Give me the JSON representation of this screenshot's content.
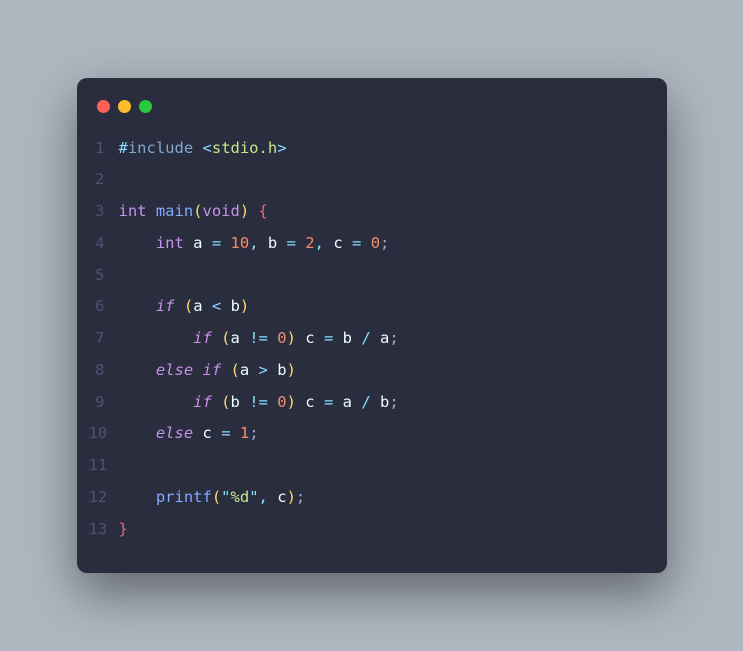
{
  "window": {
    "traffic_lights": {
      "red": "#ff5f56",
      "yellow": "#ffbd2e",
      "green": "#27c93f"
    }
  },
  "code": {
    "language": "c",
    "lines": [
      {
        "num": "1",
        "tokens": [
          [
            "mtk-dir",
            "#"
          ],
          [
            "mtk-include",
            "include"
          ],
          [
            "plain",
            " "
          ],
          [
            "mtk-dir",
            "<"
          ],
          [
            "mtk-str",
            "stdio.h"
          ],
          [
            "mtk-dir",
            ">"
          ]
        ]
      },
      {
        "num": "2",
        "tokens": []
      },
      {
        "num": "3",
        "tokens": [
          [
            "mtk-type",
            "int"
          ],
          [
            "plain",
            " "
          ],
          [
            "mtk-fn",
            "main"
          ],
          [
            "mtk-paren",
            "("
          ],
          [
            "mtk-type",
            "void"
          ],
          [
            "mtk-paren",
            ")"
          ],
          [
            "plain",
            " "
          ],
          [
            "mtk-brace",
            "{"
          ]
        ]
      },
      {
        "num": "4",
        "tokens": [
          [
            "plain",
            "    "
          ],
          [
            "mtk-type",
            "int"
          ],
          [
            "plain",
            " "
          ],
          [
            "mtk-var",
            "a"
          ],
          [
            "plain",
            " "
          ],
          [
            "mtk-op",
            "="
          ],
          [
            "plain",
            " "
          ],
          [
            "mtk-num",
            "10"
          ],
          [
            "mtk-punc",
            ","
          ],
          [
            "plain",
            " "
          ],
          [
            "mtk-var",
            "b"
          ],
          [
            "plain",
            " "
          ],
          [
            "mtk-op",
            "="
          ],
          [
            "plain",
            " "
          ],
          [
            "mtk-num",
            "2"
          ],
          [
            "mtk-punc",
            ","
          ],
          [
            "plain",
            " "
          ],
          [
            "mtk-var",
            "c"
          ],
          [
            "plain",
            " "
          ],
          [
            "mtk-op",
            "="
          ],
          [
            "plain",
            " "
          ],
          [
            "mtk-num",
            "0"
          ],
          [
            "mtk-semi",
            ";"
          ]
        ]
      },
      {
        "num": "5",
        "tokens": []
      },
      {
        "num": "6",
        "tokens": [
          [
            "plain",
            "    "
          ],
          [
            "mtk-kw",
            "if"
          ],
          [
            "plain",
            " "
          ],
          [
            "mtk-paren",
            "("
          ],
          [
            "mtk-var",
            "a"
          ],
          [
            "plain",
            " "
          ],
          [
            "mtk-op",
            "<"
          ],
          [
            "plain",
            " "
          ],
          [
            "mtk-var",
            "b"
          ],
          [
            "mtk-paren",
            ")"
          ]
        ]
      },
      {
        "num": "7",
        "tokens": [
          [
            "plain",
            "        "
          ],
          [
            "mtk-kw",
            "if"
          ],
          [
            "plain",
            " "
          ],
          [
            "mtk-paren",
            "("
          ],
          [
            "mtk-var",
            "a"
          ],
          [
            "plain",
            " "
          ],
          [
            "mtk-op",
            "!="
          ],
          [
            "plain",
            " "
          ],
          [
            "mtk-num",
            "0"
          ],
          [
            "mtk-paren",
            ")"
          ],
          [
            "plain",
            " "
          ],
          [
            "mtk-var",
            "c"
          ],
          [
            "plain",
            " "
          ],
          [
            "mtk-op",
            "="
          ],
          [
            "plain",
            " "
          ],
          [
            "mtk-var",
            "b"
          ],
          [
            "plain",
            " "
          ],
          [
            "mtk-op",
            "/"
          ],
          [
            "plain",
            " "
          ],
          [
            "mtk-var",
            "a"
          ],
          [
            "mtk-semi",
            ";"
          ]
        ]
      },
      {
        "num": "8",
        "tokens": [
          [
            "plain",
            "    "
          ],
          [
            "mtk-kw",
            "else"
          ],
          [
            "plain",
            " "
          ],
          [
            "mtk-kw",
            "if"
          ],
          [
            "plain",
            " "
          ],
          [
            "mtk-paren",
            "("
          ],
          [
            "mtk-var",
            "a"
          ],
          [
            "plain",
            " "
          ],
          [
            "mtk-op",
            ">"
          ],
          [
            "plain",
            " "
          ],
          [
            "mtk-var",
            "b"
          ],
          [
            "mtk-paren",
            ")"
          ]
        ]
      },
      {
        "num": "9",
        "tokens": [
          [
            "plain",
            "        "
          ],
          [
            "mtk-kw",
            "if"
          ],
          [
            "plain",
            " "
          ],
          [
            "mtk-paren",
            "("
          ],
          [
            "mtk-var",
            "b"
          ],
          [
            "plain",
            " "
          ],
          [
            "mtk-op",
            "!="
          ],
          [
            "plain",
            " "
          ],
          [
            "mtk-num",
            "0"
          ],
          [
            "mtk-paren",
            ")"
          ],
          [
            "plain",
            " "
          ],
          [
            "mtk-var",
            "c"
          ],
          [
            "plain",
            " "
          ],
          [
            "mtk-op",
            "="
          ],
          [
            "plain",
            " "
          ],
          [
            "mtk-var",
            "a"
          ],
          [
            "plain",
            " "
          ],
          [
            "mtk-op",
            "/"
          ],
          [
            "plain",
            " "
          ],
          [
            "mtk-var",
            "b"
          ],
          [
            "mtk-semi",
            ";"
          ]
        ]
      },
      {
        "num": "10",
        "tokens": [
          [
            "plain",
            "    "
          ],
          [
            "mtk-kw",
            "else"
          ],
          [
            "plain",
            " "
          ],
          [
            "mtk-var",
            "c"
          ],
          [
            "plain",
            " "
          ],
          [
            "mtk-op",
            "="
          ],
          [
            "plain",
            " "
          ],
          [
            "mtk-num",
            "1"
          ],
          [
            "mtk-semi",
            ";"
          ]
        ]
      },
      {
        "num": "11",
        "tokens": []
      },
      {
        "num": "12",
        "tokens": [
          [
            "plain",
            "    "
          ],
          [
            "mtk-fn",
            "printf"
          ],
          [
            "mtk-paren",
            "("
          ],
          [
            "mtk-punc",
            "\""
          ],
          [
            "mtk-str",
            "%d"
          ],
          [
            "mtk-punc",
            "\""
          ],
          [
            "mtk-punc",
            ","
          ],
          [
            "plain",
            " "
          ],
          [
            "mtk-var",
            "c"
          ],
          [
            "mtk-paren",
            ")"
          ],
          [
            "mtk-semi",
            ";"
          ]
        ]
      },
      {
        "num": "13",
        "tokens": [
          [
            "mtk-brace",
            "}"
          ]
        ]
      }
    ]
  }
}
